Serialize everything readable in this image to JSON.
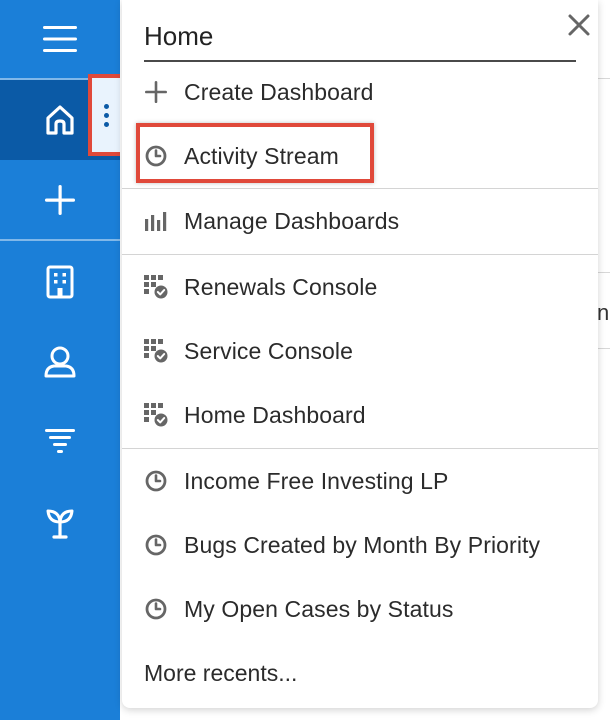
{
  "search": {
    "value": "Home"
  },
  "menu": {
    "items": [
      {
        "label": "Create Dashboard",
        "icon": "plus-icon"
      },
      {
        "label": "Activity Stream",
        "icon": "clock-icon"
      },
      {
        "label": "Manage Dashboards",
        "icon": "bar-chart-icon"
      },
      {
        "label": "Renewals Console",
        "icon": "dashboard-check-icon"
      },
      {
        "label": "Service Console",
        "icon": "dashboard-check-icon"
      },
      {
        "label": "Home Dashboard",
        "icon": "dashboard-check-icon"
      },
      {
        "label": "Income Free Investing LP",
        "icon": "clock-icon"
      },
      {
        "label": "Bugs Created by Month By Priority",
        "icon": "clock-icon"
      },
      {
        "label": "My Open Cases by Status",
        "icon": "clock-icon"
      }
    ],
    "more_label": "More recents..."
  },
  "background": {
    "fragment_text": "nn"
  },
  "colors": {
    "sidebar": "#1b7fd8",
    "sidebar_active": "#0b5aa6",
    "highlight": "#e0493a",
    "icon_gray": "#6b6b6b"
  },
  "sidebar": {
    "icons": [
      "hamburger-icon",
      "home-icon",
      "plus-icon",
      "building-icon",
      "person-icon",
      "filter-icon",
      "sprout-icon"
    ]
  }
}
